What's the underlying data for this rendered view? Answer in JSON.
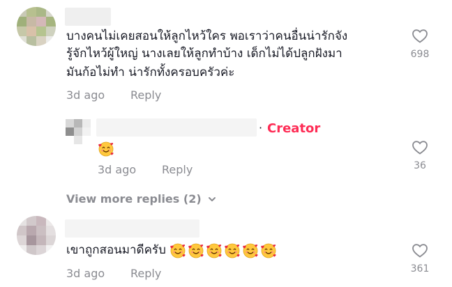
{
  "comments": [
    {
      "text_lines": [
        "บางคนไม่เคยสอนให้ลูกไหว้ใคร พอเราว่าคนอื่นน่ารักจัง",
        "รู้จักไหว้ผู้ใหญ่ นางเลยให้ลูกทำบ้าง เด็กไม่ได้ปลูกฝังมา",
        "มันก้อไม่ทำ น่ารักทั้งครอบครัวค่ะ"
      ],
      "date": "3d ago",
      "reply_label": "Reply",
      "likes": "698"
    },
    {
      "creator_separator": "·",
      "creator_label": "Creator",
      "emoji_icon": "smiling-face-with-hearts",
      "date": "3d ago",
      "reply_label": "Reply",
      "likes": "36"
    },
    {
      "text": "เขาถูกสอนมาดีครับ",
      "emoji_icon": "smiling-face-with-hearts",
      "emoji_count": 6,
      "date": "3d ago",
      "reply_label": "Reply",
      "likes": "361"
    }
  ],
  "view_more_label": "View more replies (2)",
  "colors": {
    "creator": "#fe2c55",
    "muted": "#8a8b91",
    "text": "#161823",
    "emoji_face": "#ffc83d",
    "emoji_heart": "#e8283c"
  }
}
